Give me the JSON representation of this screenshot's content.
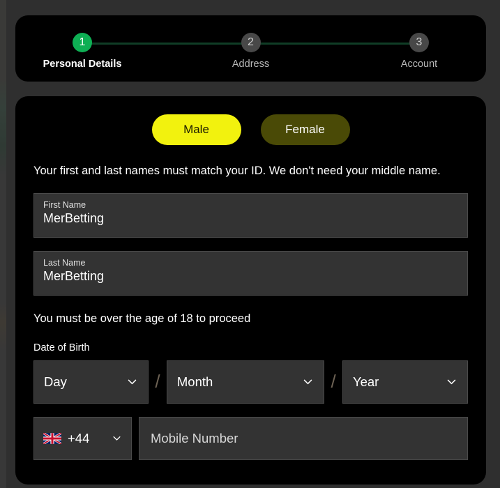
{
  "theme": {
    "page_background": "#2f2f2f",
    "card_background": "#000000",
    "field_background": "#333333",
    "accent_green": "#0eaf54",
    "accent_yellow": "#f2f20e",
    "accent_olive": "#4a4a06",
    "connector_line": "#103d26",
    "inactive_circle": "#484848"
  },
  "stepper": {
    "steps": [
      {
        "number": "1",
        "label": "Personal Details",
        "state": "active"
      },
      {
        "number": "2",
        "label": "Address",
        "state": "inactive"
      },
      {
        "number": "3",
        "label": "Account",
        "state": "inactive"
      }
    ]
  },
  "form": {
    "gender": {
      "selected": "Male",
      "options": [
        {
          "label": "Male",
          "state": "selected"
        },
        {
          "label": "Female",
          "state": "unselected"
        }
      ]
    },
    "helper_text": "Your first and last names must match your ID. We don't need your middle name.",
    "first_name": {
      "label": "First Name",
      "value": "MerBetting",
      "placeholder": ""
    },
    "last_name": {
      "label": "Last Name",
      "value": "MerBetting",
      "placeholder": ""
    },
    "age_notice": "You must be over the age of 18 to proceed",
    "date_of_birth": {
      "label": "Date of Birth",
      "separator": "/",
      "day": {
        "value": "Day",
        "icon": "chevron-down-icon"
      },
      "month": {
        "value": "Month",
        "icon": "chevron-down-icon"
      },
      "year": {
        "value": "Year",
        "icon": "chevron-down-icon"
      }
    },
    "phone": {
      "country_flag_icon": "united-kingdom-flag-icon",
      "dial_code": "+44",
      "dropdown_icon": "chevron-down-icon",
      "mobile_placeholder": "Mobile Number",
      "mobile_value": ""
    }
  }
}
